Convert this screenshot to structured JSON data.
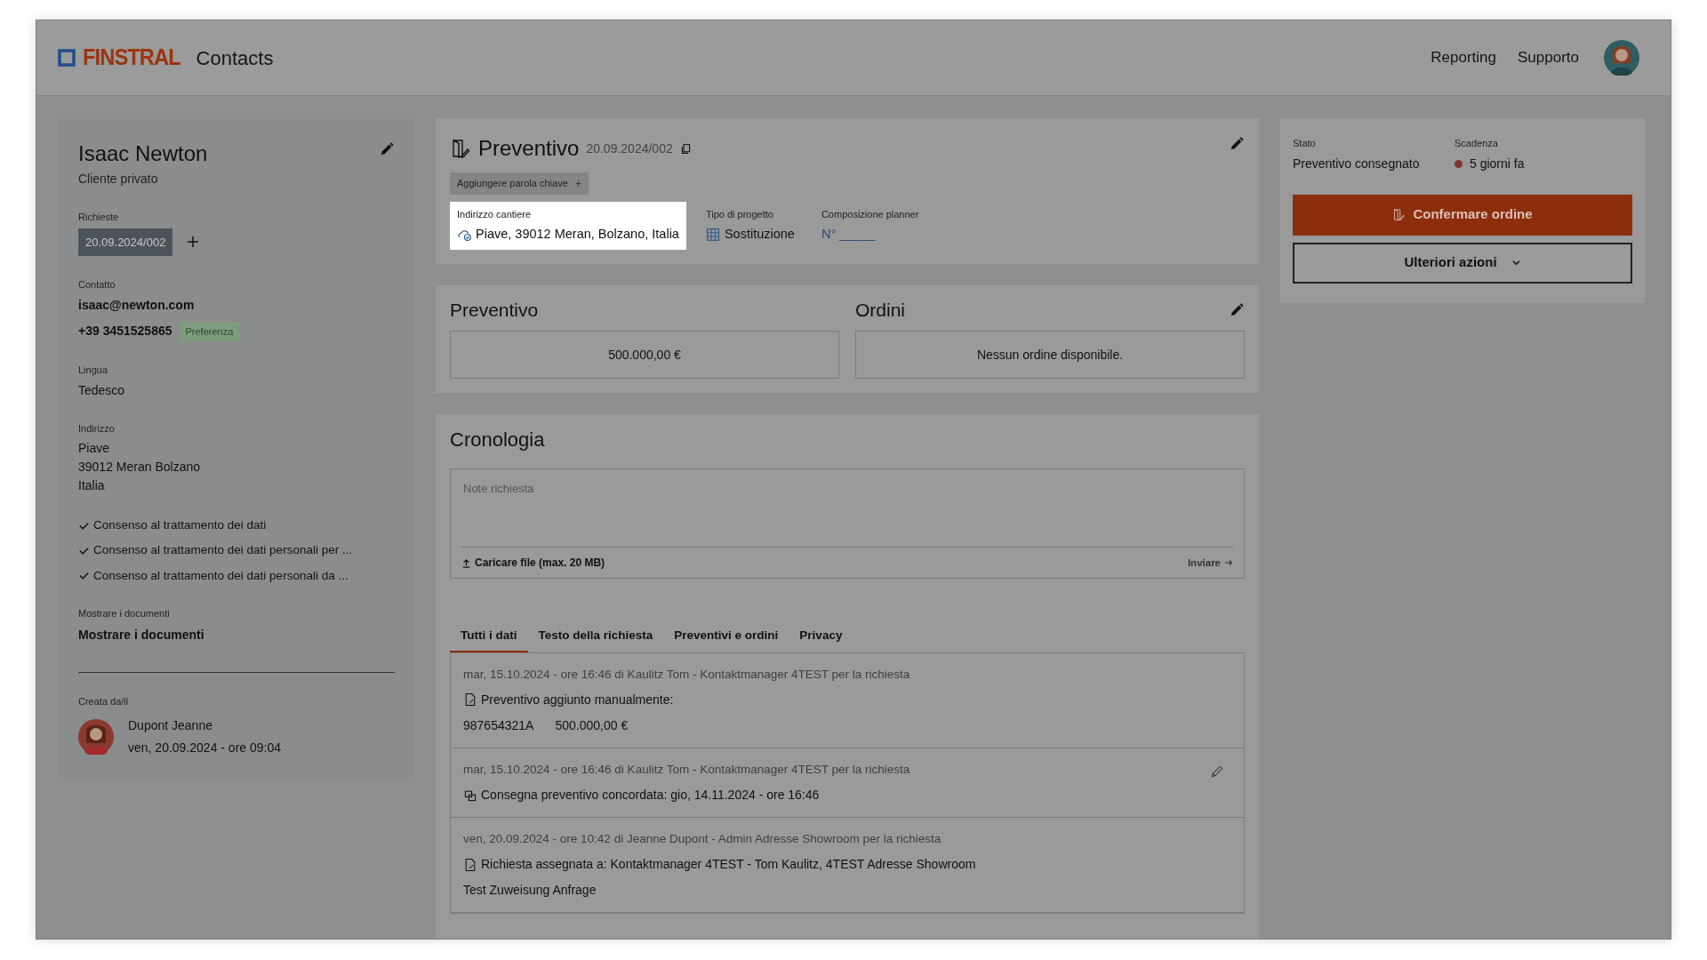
{
  "header": {
    "brand": "FINSTRAL",
    "app": "Contacts",
    "nav": [
      {
        "label": "Reporting"
      },
      {
        "label": "Supporto"
      }
    ]
  },
  "contact": {
    "name": "Isaac Newton",
    "type": "Cliente privato",
    "requests_label": "Richieste",
    "requests": [
      {
        "label": "20.09.2024/002",
        "selected": true
      }
    ],
    "contact_label": "Contatto",
    "email": "isaac@newton.com",
    "phone": "+39 3451525865",
    "phone_badge": "Preferenza",
    "language_label": "Lingua",
    "language": "Tedesco",
    "address_label": "Indirizzo",
    "address_lines": [
      "Piave",
      "39012 Meran Bolzano",
      "Italia"
    ],
    "consents": [
      {
        "label": "Consenso al trattamento dei dati",
        "checked": true
      },
      {
        "label": "Consenso al trattamento dei dati personali per ...",
        "checked": true
      },
      {
        "label": "Consenso al trattamento dei dati personali da ...",
        "checked": true
      }
    ],
    "documents_label": "Mostrare i documenti",
    "documents_link": "Mostrare i documenti",
    "created_label": "Creata da/il",
    "creator": "Dupont Jeanne",
    "created_at": "ven, 20.09.2024 - ore 09:04"
  },
  "quote": {
    "title": "Preventivo",
    "number": "20.09.2024/002",
    "keyword_button": "Aggiungere parola chiave",
    "fields": [
      {
        "kind": "address",
        "label": "Indirizzo cantiere",
        "value": "Piave, 39012 Meran, Bolzano, Italia",
        "highlighted": true
      },
      {
        "kind": "project",
        "label": "Tipo di progetto",
        "value": "Sostituzione",
        "highlighted": false
      },
      {
        "kind": "planner",
        "label": "Composizione planner",
        "value": "N° _____",
        "highlighted": false
      }
    ]
  },
  "offers": {
    "quote_title": "Preventivo",
    "quote_value": "500.000,00 €",
    "orders_title": "Ordini",
    "orders_value": "Nessun ordine disponibile."
  },
  "history": {
    "title": "Cronologia",
    "note_placeholder": "Note richiesta",
    "upload": "Caricare file (max. 20 MB)",
    "send": "Inviare",
    "tabs": [
      {
        "label": "Tutti i dati",
        "selected": true
      },
      {
        "label": "Testo della richiesta",
        "selected": false
      },
      {
        "label": "Preventivi e ordini",
        "selected": false
      },
      {
        "label": "Privacy",
        "selected": false
      }
    ],
    "entries": [
      {
        "kind": "quote",
        "meta": "mar, 15.10.2024 - ore 16:46 di Kaulitz Tom - Kontaktmanager 4TEST per la richiesta",
        "text": "Preventivo aggiunto manualmente:",
        "details": [
          "987654321A",
          "500.000,00 €"
        ],
        "editable": false
      },
      {
        "kind": "delivery",
        "meta": "mar, 15.10.2024 - ore 16:46 di Kaulitz Tom - Kontaktmanager 4TEST per la richiesta",
        "text": "Consegna preventivo concordata: gio, 14.11.2024 - ore 16:46",
        "editable": true
      },
      {
        "kind": "assign",
        "meta": "ven, 20.09.2024 - ore 10:42 di Jeanne Dupont - Admin Adresse Showroom per la richiesta",
        "text": "Richiesta assegnata a: Kontaktmanager 4TEST - Tom Kaulitz, 4TEST Adresse Showroom",
        "details": [
          "Test Zuweisung Anfrage"
        ],
        "editable": false
      }
    ]
  },
  "status": {
    "state_label": "Stato",
    "state": "Preventivo consegnato",
    "due_label": "Scadenza",
    "due": "5 giorni fa",
    "confirm_button": "Confermare ordine",
    "more_button": "Ulteriori azioni"
  }
}
